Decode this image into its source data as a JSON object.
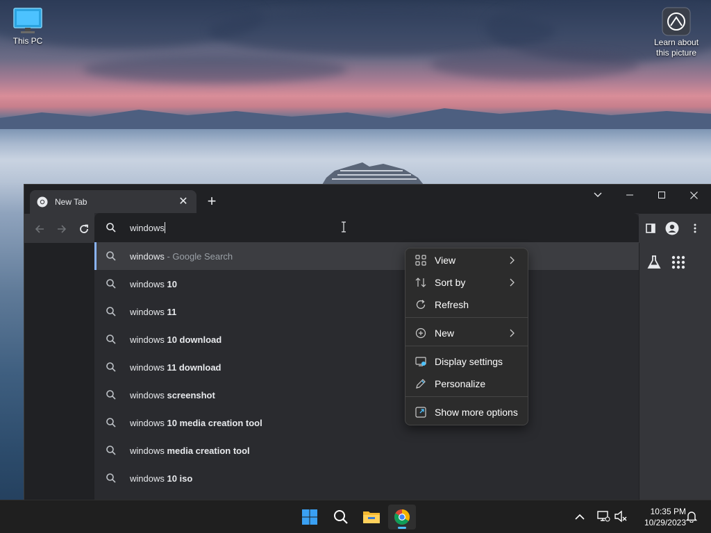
{
  "desktop": {
    "icons": [
      {
        "label": "This PC"
      },
      {
        "label": "Learn about this picture"
      }
    ]
  },
  "browser": {
    "tab": {
      "title": "New Tab"
    },
    "new_tab_symbol": "+",
    "omnibox": {
      "value": "windows",
      "suggestions": [
        {
          "query": "windows",
          "suffix": "",
          "hint": " - Google Search",
          "selected": true
        },
        {
          "query": "windows",
          "suffix": " 10"
        },
        {
          "query": "windows",
          "suffix": " 11"
        },
        {
          "query": "windows",
          "suffix": " 10 download"
        },
        {
          "query": "windows",
          "suffix": " 11 download"
        },
        {
          "query": "windows",
          "suffix": " screenshot"
        },
        {
          "query": "windows",
          "suffix": " 10 media creation tool"
        },
        {
          "query": "windows",
          "suffix": " media creation tool"
        },
        {
          "query": "windows",
          "suffix": " 10 iso"
        }
      ]
    }
  },
  "context_menu": {
    "items": [
      {
        "label": "View",
        "icon": "grid-icon",
        "submenu": true
      },
      {
        "label": "Sort by",
        "icon": "sort-icon",
        "submenu": true
      },
      {
        "label": "Refresh",
        "icon": "refresh-icon",
        "submenu": false
      },
      {
        "label": "New",
        "icon": "plus-circle-icon",
        "submenu": true
      },
      {
        "label": "Display settings",
        "icon": "display-icon",
        "submenu": false
      },
      {
        "label": "Personalize",
        "icon": "pen-icon",
        "submenu": false
      },
      {
        "label": "Show more options",
        "icon": "expand-icon",
        "submenu": false
      }
    ]
  },
  "taskbar": {
    "time": "10:35 PM",
    "date": "10/29/2023"
  },
  "colors": {
    "accent": "#8ab4f8",
    "taskbar_indicator": "#4cc2ff"
  }
}
